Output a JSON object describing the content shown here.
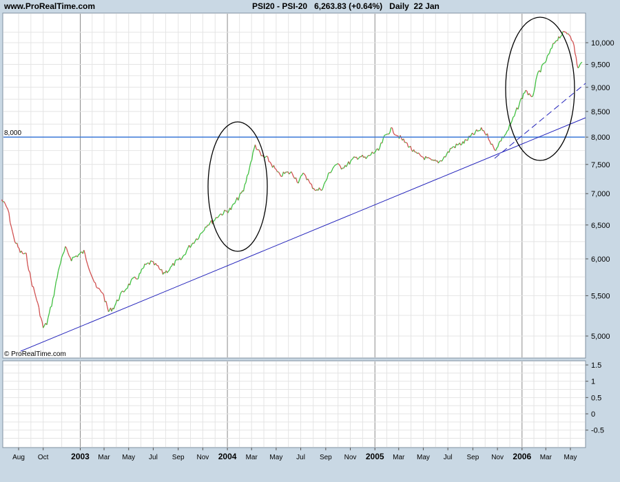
{
  "header": {
    "site": "www.ProRealTime.com",
    "symbol": "PSI20 - PSI-20",
    "last_value": "6,263.83 (+0.64%)",
    "period": "Daily",
    "date": "22 Jan"
  },
  "watermark": "© ProRealTime.com",
  "colors": {
    "background": "#c9d8e4",
    "panel": "#ffffff",
    "grid": "#e4e4e4",
    "up_candle": "#3fbf3f",
    "down_candle": "#d05050",
    "trendline": "#2222bb",
    "horizontal_line": "#3a78d8",
    "ellipse": "#000000"
  },
  "chart_data": [
    {
      "type": "line",
      "title": "",
      "y_scale": "log",
      "ylim": [
        4800,
        10500
      ],
      "yticks": [
        "5,000",
        "5,500",
        "6,000",
        "6,500",
        "7,000",
        "7,500",
        "8,000",
        "8,500",
        "9,000",
        "9,500",
        "10,000"
      ],
      "ytick_values": [
        5000,
        5500,
        6000,
        6500,
        7000,
        7500,
        8000,
        8500,
        9000,
        9500,
        10000
      ],
      "x_tick_labels": [
        "Aug",
        "Oct",
        "2003",
        "Mar",
        "May",
        "Jul",
        "Sep",
        "Nov",
        "2004",
        "Mar",
        "May",
        "Jul",
        "Sep",
        "Nov",
        "2005",
        "Mar",
        "May",
        "Jul",
        "Sep",
        "Nov",
        "2006",
        "Mar",
        "May"
      ],
      "x_tick_dates": [
        "2002-08-01",
        "2002-10-01",
        "2003-01-01",
        "2003-03-01",
        "2003-05-01",
        "2003-07-01",
        "2003-09-01",
        "2003-11-01",
        "2004-01-01",
        "2004-03-01",
        "2004-05-01",
        "2004-07-01",
        "2004-09-01",
        "2004-11-01",
        "2005-01-01",
        "2005-03-01",
        "2005-05-01",
        "2005-07-01",
        "2005-09-01",
        "2005-11-01",
        "2006-01-01",
        "2006-03-01",
        "2006-05-01"
      ],
      "x_bold_labels": [
        "2003",
        "2004",
        "2005",
        "2006"
      ],
      "series": [
        {
          "x": [
            "2002-06-20",
            "2002-07-05",
            "2002-07-20",
            "2002-08-05",
            "2002-08-20",
            "2002-09-01",
            "2002-09-15",
            "2002-10-01",
            "2002-10-10",
            "2002-10-25",
            "2002-11-10",
            "2002-11-25",
            "2002-12-10",
            "2002-12-25",
            "2003-01-10",
            "2003-01-25",
            "2003-02-10",
            "2003-02-25",
            "2003-03-12",
            "2003-03-25",
            "2003-04-10",
            "2003-04-25",
            "2003-05-10",
            "2003-05-25",
            "2003-06-10",
            "2003-06-25",
            "2003-07-10",
            "2003-07-25",
            "2003-08-10",
            "2003-08-25",
            "2003-09-10",
            "2003-09-25",
            "2003-10-10",
            "2003-10-25",
            "2003-11-10",
            "2003-11-25",
            "2003-12-10",
            "2003-12-25",
            "2004-01-10",
            "2004-01-25",
            "2004-02-10",
            "2004-02-25",
            "2004-03-10",
            "2004-03-25",
            "2004-04-10",
            "2004-04-25",
            "2004-05-10",
            "2004-05-25",
            "2004-06-10",
            "2004-06-25",
            "2004-07-10",
            "2004-07-25",
            "2004-08-10",
            "2004-08-25",
            "2004-09-10",
            "2004-09-25",
            "2004-10-10",
            "2004-10-25",
            "2004-11-10",
            "2004-11-25",
            "2004-12-10",
            "2004-12-25",
            "2005-01-10",
            "2005-01-25",
            "2005-02-10",
            "2005-02-25",
            "2005-03-10",
            "2005-03-25",
            "2005-04-10",
            "2005-04-25",
            "2005-05-10",
            "2005-05-25",
            "2005-06-10",
            "2005-06-25",
            "2005-07-10",
            "2005-07-25",
            "2005-08-10",
            "2005-08-25",
            "2005-09-10",
            "2005-09-25",
            "2005-10-10",
            "2005-10-25",
            "2005-11-10",
            "2005-11-25",
            "2005-12-10",
            "2005-12-25",
            "2006-01-10",
            "2006-01-25",
            "2006-02-10",
            "2006-02-25",
            "2006-03-10",
            "2006-03-25",
            "2006-04-10",
            "2006-04-20",
            "2006-05-01",
            "2006-05-10",
            "2006-05-20",
            "2006-05-30"
          ],
          "values": [
            6900,
            6750,
            6300,
            6100,
            6050,
            5700,
            5450,
            5100,
            5150,
            5450,
            5900,
            6150,
            6000,
            6050,
            6100,
            5850,
            5600,
            5550,
            5300,
            5350,
            5500,
            5600,
            5700,
            5750,
            5900,
            5950,
            5900,
            5800,
            5850,
            5950,
            6000,
            6150,
            6250,
            6350,
            6500,
            6550,
            6650,
            6700,
            6750,
            6900,
            7050,
            7450,
            7850,
            7650,
            7600,
            7450,
            7300,
            7350,
            7350,
            7200,
            7350,
            7150,
            7050,
            7100,
            7350,
            7500,
            7450,
            7500,
            7600,
            7650,
            7600,
            7700,
            7750,
            8000,
            8150,
            8050,
            7950,
            7850,
            7700,
            7650,
            7600,
            7550,
            7550,
            7650,
            7800,
            7850,
            7900,
            8000,
            8100,
            8150,
            8000,
            7750,
            7950,
            8100,
            8350,
            8650,
            8950,
            8750,
            9300,
            9500,
            9750,
            10050,
            10200,
            10250,
            10200,
            9900,
            9400,
            9550
          ]
        }
      ],
      "annotations": {
        "horizontal_line_label": "8,000",
        "horizontal_line_value": 8000
      }
    },
    {
      "type": "line",
      "title": "",
      "ylim": [
        -0.85,
        1.6
      ],
      "yticks": [
        "1.5",
        "1",
        "0.5",
        "0",
        "-0.5"
      ],
      "ytick_values": [
        1.5,
        1,
        0.5,
        0,
        -0.5
      ]
    }
  ]
}
